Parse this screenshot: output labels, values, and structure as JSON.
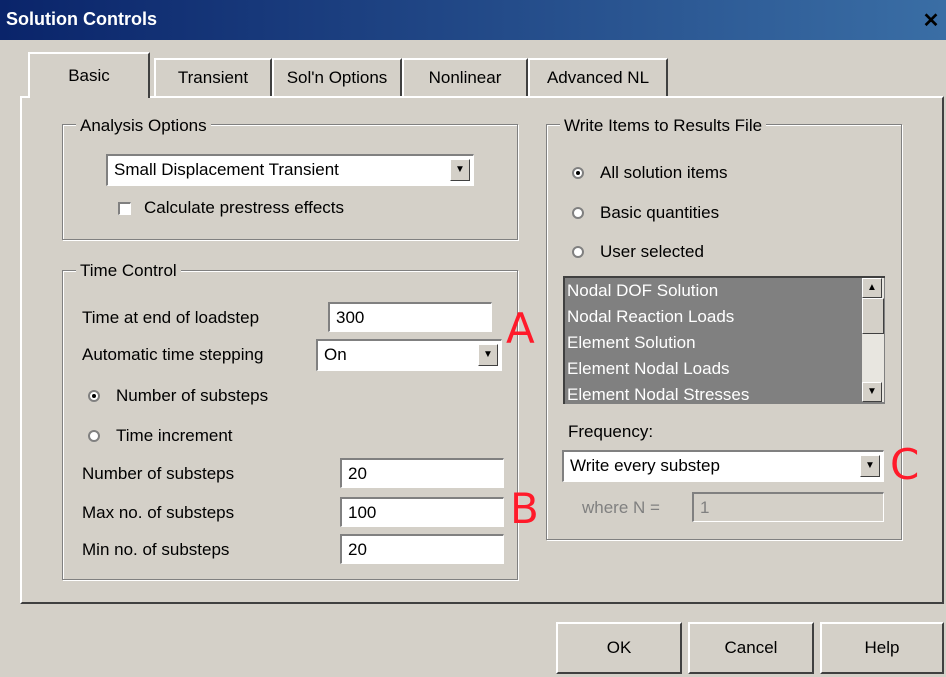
{
  "window": {
    "title": "Solution Controls"
  },
  "tabs": [
    {
      "label": "Basic",
      "active": true
    },
    {
      "label": "Transient",
      "active": false
    },
    {
      "label": "Sol'n Options",
      "active": false
    },
    {
      "label": "Nonlinear",
      "active": false
    },
    {
      "label": "Advanced NL",
      "active": false
    }
  ],
  "analysis_options": {
    "legend": "Analysis Options",
    "type_value": "Small Displacement Transient",
    "prestress_label": "Calculate prestress effects",
    "prestress_checked": false
  },
  "time_control": {
    "legend": "Time Control",
    "end_time_label": "Time at end of loadstep",
    "end_time_value": "300",
    "auto_step_label": "Automatic time stepping",
    "auto_step_value": "On",
    "radio_substeps_label": "Number of substeps",
    "radio_increment_label": "Time increment",
    "num_substeps_label": "Number of substeps",
    "num_substeps_value": "20",
    "max_substeps_label": "Max no. of substeps",
    "max_substeps_value": "100",
    "min_substeps_label": "Min no. of substeps",
    "min_substeps_value": "20"
  },
  "results_file": {
    "legend": "Write Items to Results File",
    "radio_all": "All solution items",
    "radio_basic": "Basic quantities",
    "radio_user": "User selected",
    "items": [
      "Nodal DOF Solution",
      "Nodal Reaction Loads",
      "Element Solution",
      "Element Nodal Loads",
      "Element Nodal Stresses"
    ],
    "frequency_label": "Frequency:",
    "frequency_value": "Write every substep",
    "where_label": "where N =",
    "where_value": "1"
  },
  "buttons": {
    "ok": "OK",
    "cancel": "Cancel",
    "help": "Help"
  },
  "annotations": {
    "a": "A",
    "b": "B",
    "c": "C"
  },
  "colors": {
    "annotation": "#ff1a2a",
    "titlebar": "#0a246a",
    "face": "#d4d0c8"
  }
}
